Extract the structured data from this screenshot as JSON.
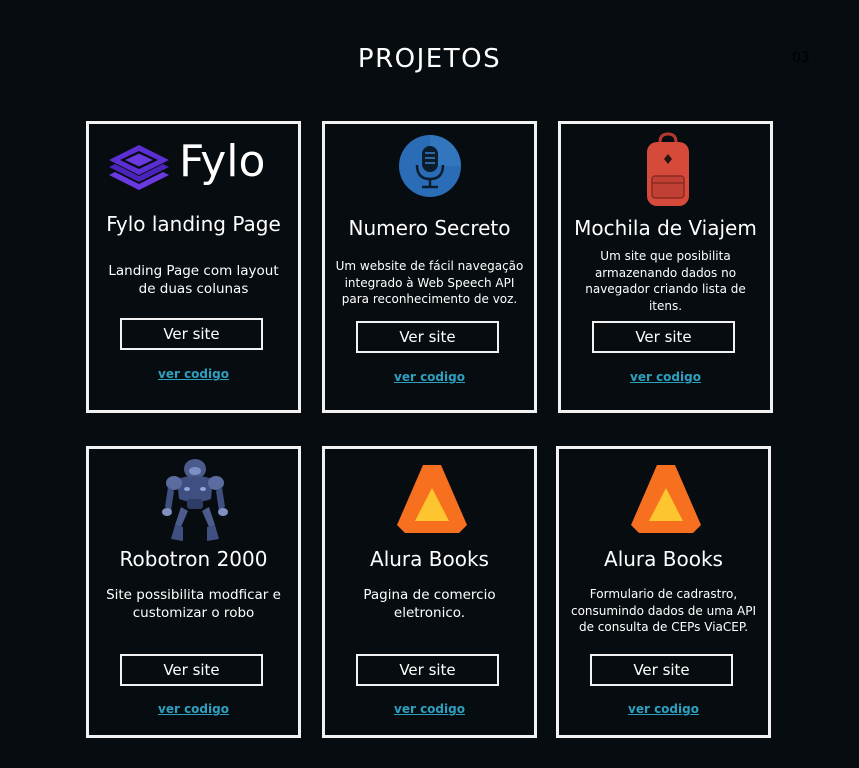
{
  "page_title": "PROJETOS",
  "page_number": "03",
  "projects": [
    {
      "logo_text": "Fylo",
      "name": "Fylo landing Page",
      "description": "Landing Page com layout de duas colunas",
      "site_label": "Ver site",
      "code_label": "ver codigo",
      "icon": "fylo-logo-icon"
    },
    {
      "name": "Numero Secreto",
      "description": "Um website de fácil navegação integrado à Web Speech API para reconhecimento de voz.",
      "site_label": "Ver site",
      "code_label": "ver codigo",
      "icon": "microphone-icon"
    },
    {
      "name": "Mochila de Viajem",
      "description": "Um site que posibilita armazenando dados no navegador criando lista de itens.",
      "site_label": "Ver site",
      "code_label": "ver codigo",
      "icon": "backpack-icon"
    },
    {
      "name": "Robotron 2000",
      "description": "Site possibilita modficar e customizar o robo",
      "site_label": "Ver site",
      "code_label": "ver codigo",
      "icon": "robot-icon"
    },
    {
      "name": "Alura Books",
      "description": "Pagina de comercio eletronico.",
      "site_label": "Ver site",
      "code_label": "ver codigo",
      "icon": "alura-logo-icon"
    },
    {
      "name": "Alura Books",
      "description": "Formulario de cadrastro, consumindo dados de uma API de consulta de CEPs ViaCEP.",
      "site_label": "Ver site",
      "code_label": "ver codigo",
      "icon": "alura-logo-icon"
    }
  ],
  "colors": {
    "background": "#060c10",
    "border": "#f2f2f2",
    "link": "#2ea0bf",
    "fylo_purple": "#5b2fd1",
    "alura_orange": "#f7701f",
    "alura_yellow": "#fdc530",
    "mic_blue": "#2a6cb5",
    "backpack_red": "#d64a3c"
  }
}
